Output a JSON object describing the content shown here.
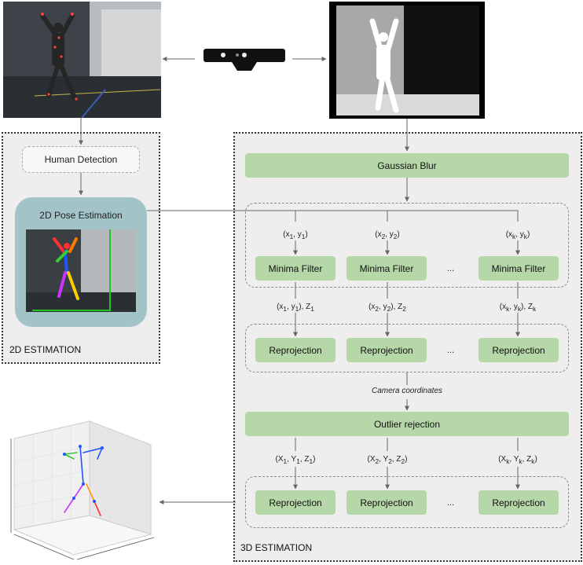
{
  "panels": {
    "left_label": "2D ESTIMATION",
    "right_label": "3D ESTIMATION"
  },
  "left": {
    "human_detection": "Human Detection",
    "pose_estimation": "2D Pose Estimation"
  },
  "right": {
    "gaussian_blur": "Gaussian Blur",
    "minima_filter": "Minima Filter",
    "reprojection": "Reprojection",
    "ellipsis": "...",
    "camera_coordinates": "Camera coordinates",
    "outlier_rejection": "Outlier rejection"
  },
  "colors": {
    "panel_bg": "#eeeeee",
    "green_box": "#b6d7a8",
    "teal_box": "#a2c4c9"
  },
  "icons": {
    "sensor": "kinect-sensor-icon"
  }
}
